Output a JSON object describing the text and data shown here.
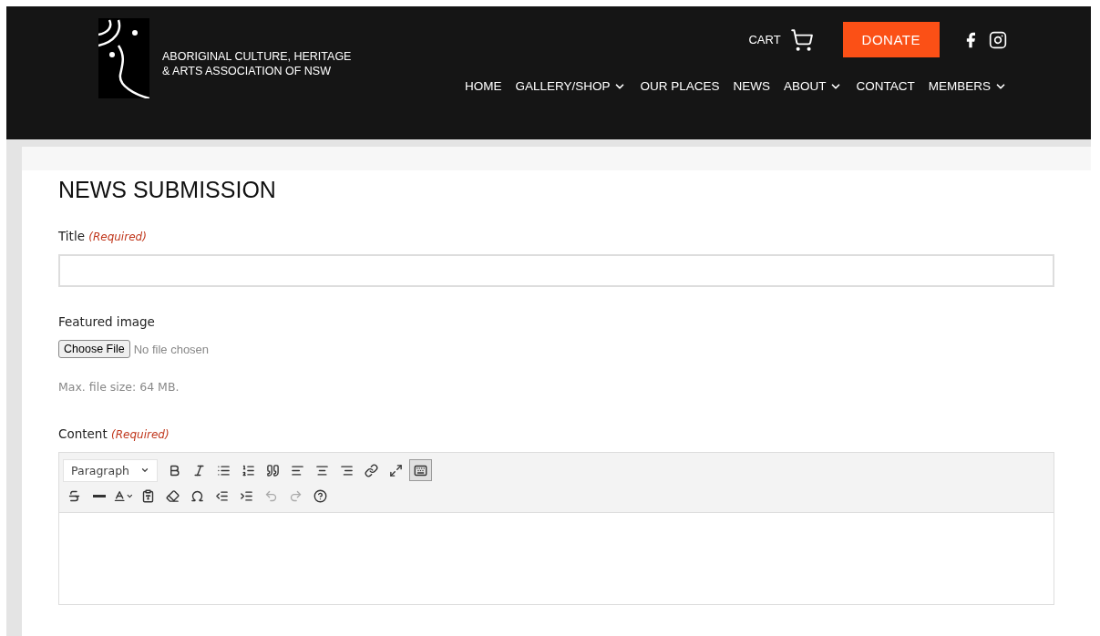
{
  "header": {
    "org_name": [
      "ABORIGINAL CULTURE, HERITAGE",
      "& ARTS ASSOCIATION OF NSW"
    ],
    "cart": {
      "label": "CART"
    },
    "donate": {
      "label": "DONATE"
    },
    "social": [
      {
        "kind": "facebook"
      },
      {
        "kind": "instagram"
      }
    ],
    "nav": [
      {
        "label": "HOME",
        "dropdown": false
      },
      {
        "label": "GALLERY/SHOP",
        "dropdown": true
      },
      {
        "label": "OUR PLACES",
        "dropdown": false
      },
      {
        "label": "NEWS",
        "dropdown": false
      },
      {
        "label": "ABOUT",
        "dropdown": true
      },
      {
        "label": "CONTACT",
        "dropdown": false
      },
      {
        "label": "MEMBERS",
        "dropdown": true
      }
    ]
  },
  "form": {
    "heading": "NEWS SUBMISSION",
    "title_field": {
      "label": "Title",
      "required_note": "(Required)"
    },
    "image_field": {
      "label": "Featured image",
      "button": "Choose File",
      "status": "No file chosen",
      "hint": "Max. file size: 64 MB."
    },
    "content_field": {
      "label": "Content",
      "required_note": "(Required)",
      "toolbar_rows": [
        [
          {
            "kind": "format-select",
            "label": "Paragraph",
            "pressed": false
          },
          {
            "kind": "bold",
            "pressed": false
          },
          {
            "kind": "italic",
            "pressed": false
          },
          {
            "kind": "bullet-list",
            "pressed": false
          },
          {
            "kind": "numbered-list",
            "pressed": false
          },
          {
            "kind": "quote",
            "pressed": false
          },
          {
            "kind": "align-left",
            "pressed": false
          },
          {
            "kind": "align-center",
            "pressed": false
          },
          {
            "kind": "align-right",
            "pressed": false
          },
          {
            "kind": "link",
            "pressed": false
          },
          {
            "kind": "fullscreen",
            "pressed": false
          },
          {
            "kind": "toolbar-toggle",
            "pressed": true
          }
        ],
        [
          {
            "kind": "strikethrough",
            "pressed": false
          },
          {
            "kind": "horizontal-line",
            "pressed": false
          },
          {
            "kind": "text-color",
            "pressed": false
          },
          {
            "kind": "paste-text",
            "pressed": false
          },
          {
            "kind": "clear-format",
            "pressed": false
          },
          {
            "kind": "special-char",
            "pressed": false
          },
          {
            "kind": "outdent",
            "pressed": false
          },
          {
            "kind": "indent",
            "pressed": false
          },
          {
            "kind": "undo",
            "pressed": false,
            "disabled": true
          },
          {
            "kind": "redo",
            "pressed": false,
            "disabled": true
          },
          {
            "kind": "help",
            "pressed": false
          }
        ]
      ]
    }
  }
}
